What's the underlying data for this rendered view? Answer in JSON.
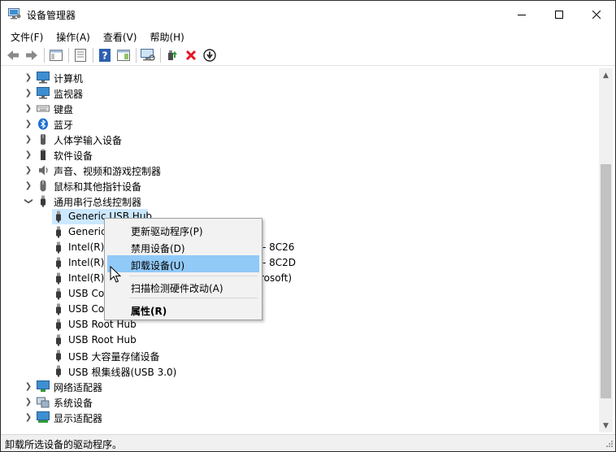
{
  "window": {
    "title": "设备管理器",
    "minimize": "—",
    "maximize": "☐",
    "close": "✕"
  },
  "menubar": {
    "items": [
      "文件(F)",
      "操作(A)",
      "查看(V)",
      "帮助(H)"
    ]
  },
  "toolbar": {
    "icons": [
      "back-icon",
      "forward-icon",
      "properties-view-icon",
      "list-view-icon",
      "help-icon",
      "details-view-icon",
      "monitor-scan-icon",
      "update-driver-icon",
      "uninstall-icon",
      "disable-device-icon"
    ]
  },
  "tree": {
    "rows": [
      {
        "label": "计算机",
        "icon": "computer-icon",
        "level": 0,
        "expander": "collapsed"
      },
      {
        "label": "监视器",
        "icon": "monitor-icon",
        "level": 0,
        "expander": "collapsed"
      },
      {
        "label": "键盘",
        "icon": "keyboard-icon",
        "level": 0,
        "expander": "collapsed"
      },
      {
        "label": "蓝牙",
        "icon": "bluetooth-icon",
        "level": 0,
        "expander": "collapsed"
      },
      {
        "label": "人体学输入设备",
        "icon": "hid-icon",
        "level": 0,
        "expander": "collapsed"
      },
      {
        "label": "软件设备",
        "icon": "software-device-icon",
        "level": 0,
        "expander": "collapsed"
      },
      {
        "label": "声音、视频和游戏控制器",
        "icon": "speaker-icon",
        "level": 0,
        "expander": "collapsed"
      },
      {
        "label": "鼠标和其他指针设备",
        "icon": "mouse-icon",
        "level": 0,
        "expander": "collapsed"
      },
      {
        "label": "通用串行总线控制器",
        "icon": "usb-icon",
        "level": 0,
        "expander": "expanded"
      },
      {
        "label": "Generic USB Hub",
        "icon": "usb-icon",
        "level": 1,
        "selected": true
      },
      {
        "label": "Generic",
        "icon": "usb-icon",
        "level": 1
      },
      {
        "label": "Intel(R)",
        "icon": "usb-icon",
        "level": 1,
        "suffix": "- 8C26"
      },
      {
        "label": "Intel(R)",
        "icon": "usb-icon",
        "level": 1,
        "suffix": "- 8C2D"
      },
      {
        "label": "Intel(R)",
        "icon": "usb-icon",
        "level": 1,
        "suffix": "rosoft)"
      },
      {
        "label": "USB Co",
        "icon": "usb-icon",
        "level": 1
      },
      {
        "label": "USB Co",
        "icon": "usb-icon",
        "level": 1
      },
      {
        "label": "USB Root Hub",
        "icon": "usb-icon",
        "level": 1
      },
      {
        "label": "USB Root Hub",
        "icon": "usb-icon",
        "level": 1
      },
      {
        "label": "USB 大容量存储设备",
        "icon": "usb-icon",
        "level": 1
      },
      {
        "label": "USB 根集线器(USB 3.0)",
        "icon": "usb-icon",
        "level": 1
      },
      {
        "label": "网络适配器",
        "icon": "network-adapter-icon",
        "level": 0,
        "expander": "collapsed"
      },
      {
        "label": "系统设备",
        "icon": "system-device-icon",
        "level": 0,
        "expander": "collapsed"
      },
      {
        "label": "显示适配器",
        "icon": "display-adapter-icon",
        "level": 0,
        "expander": "collapsed"
      }
    ]
  },
  "context_menu": {
    "items": [
      {
        "label": "更新驱动程序(P)"
      },
      {
        "label": "禁用设备(D)"
      },
      {
        "label": "卸载设备(U)",
        "highlighted": true
      },
      {
        "label": "扫描检测硬件改动(A)"
      },
      {
        "label": "属性(R)",
        "bold": true
      }
    ]
  },
  "statusbar": {
    "text": "卸载所选设备的驱动程序。"
  },
  "colors": {
    "selection": "#cce8ff",
    "menu_highlight": "#91c9f7",
    "uninstall_red": "#e81123"
  }
}
